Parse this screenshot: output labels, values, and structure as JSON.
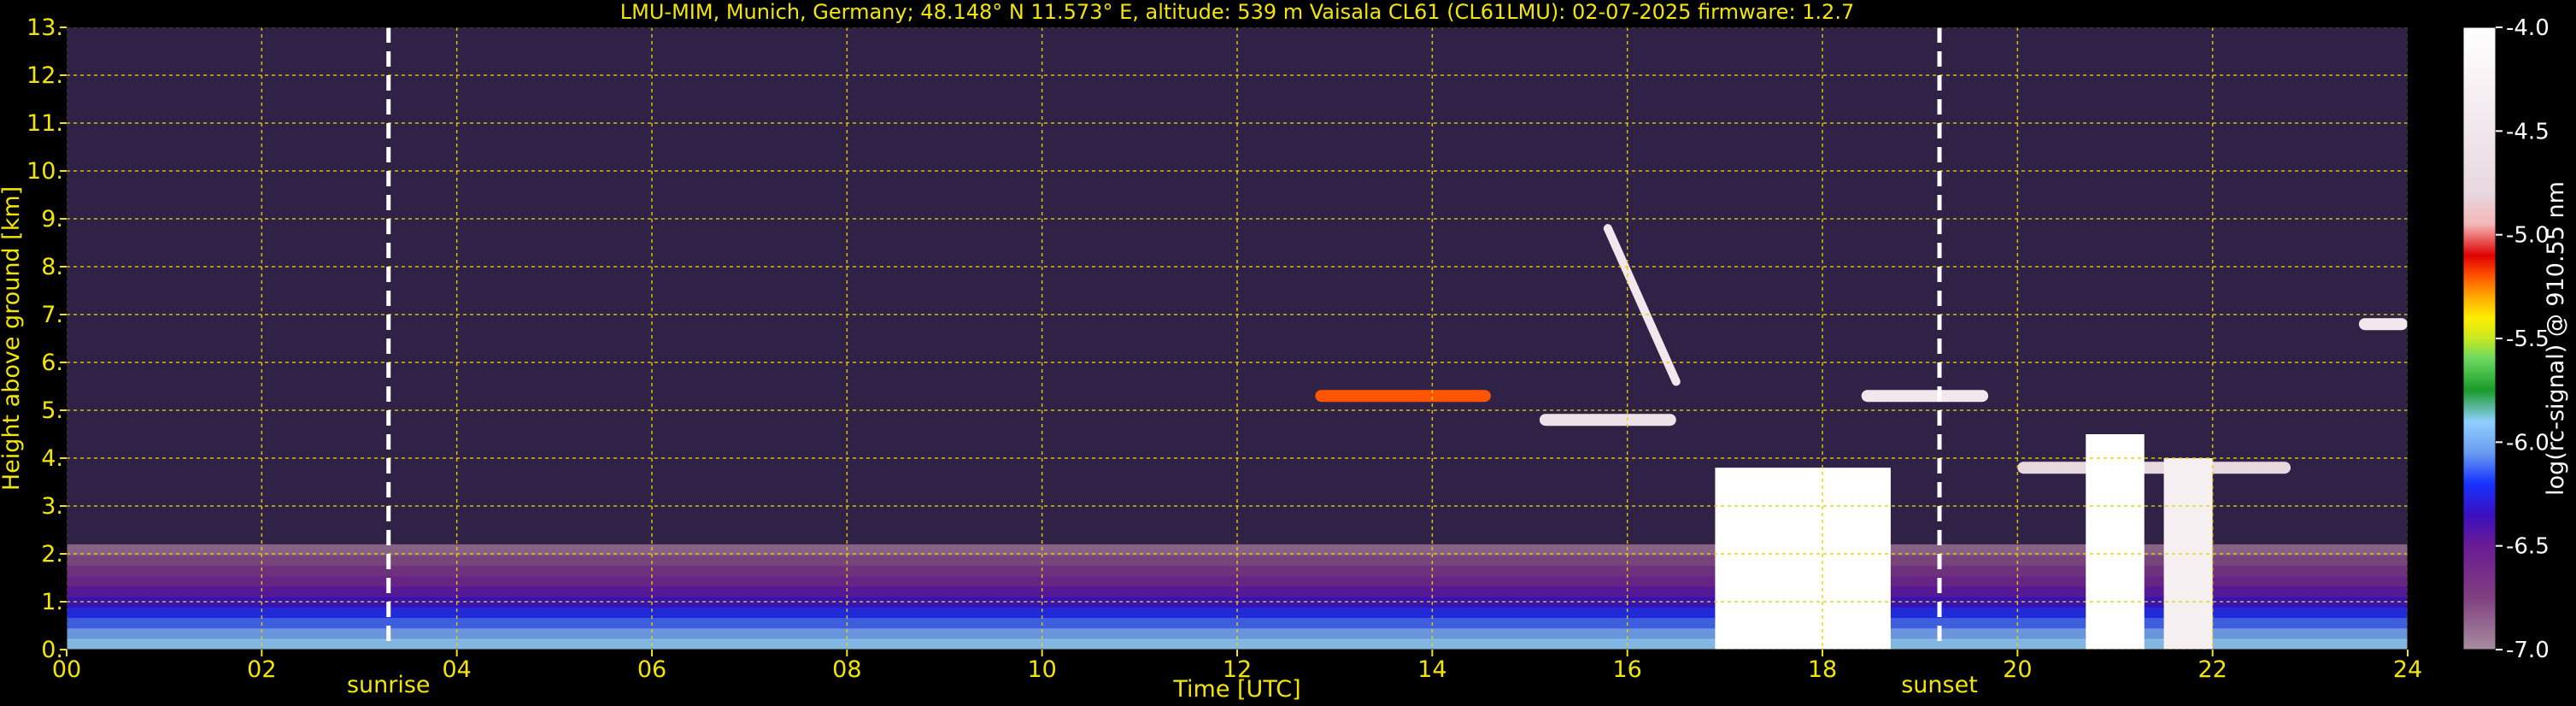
{
  "chart_data": {
    "type": "heatmap",
    "title": "LMU-MIM, Munich, Germany; 48.148° N 11.573° E, altitude: 539 m    Vaisala CL61 (CL61LMU): 02-07-2025    firmware: 1.2.7",
    "xlabel": "Time [UTC]",
    "ylabel": "Height above ground [km]",
    "colorbar_label": "log(rc-signal) @ 910.55 nm",
    "xlim": [
      0,
      24
    ],
    "ylim": [
      0,
      13
    ],
    "x_ticks": [
      "00",
      "02",
      "04",
      "06",
      "08",
      "10",
      "12",
      "14",
      "16",
      "18",
      "20",
      "22",
      "24"
    ],
    "y_ticks": [
      "0.",
      "1.",
      "2.",
      "3.",
      "4.",
      "5.",
      "6.",
      "7.",
      "8.",
      "9.",
      "10.",
      "11.",
      "12.",
      "13."
    ],
    "colorbar_range": [
      -7.0,
      -4.0
    ],
    "colorbar_ticks": [
      "-7.0",
      "-6.5",
      "-6.0",
      "-5.5",
      "-5.0",
      "-4.5",
      "-4.0"
    ],
    "grid": true,
    "annotations": [
      {
        "label": "sunrise",
        "x": 3.3
      },
      {
        "label": "sunset",
        "x": 19.2
      }
    ],
    "features": [
      {
        "kind": "aerosol_layer",
        "t_start": 0,
        "t_end": 24,
        "h_bottom": 0.0,
        "h_top": 2.2,
        "level": -6.3
      },
      {
        "kind": "cloud_layer",
        "t_start": 12.8,
        "t_end": 14.6,
        "h": 5.3,
        "level": -5.2
      },
      {
        "kind": "cloud_layer",
        "t_start": 15.1,
        "t_end": 16.5,
        "h": 4.8,
        "level": -4.6
      },
      {
        "kind": "cirrus_fall",
        "t_start": 15.8,
        "t_end": 16.5,
        "h_top": 8.8,
        "h_bottom": 5.6,
        "level": -4.5
      },
      {
        "kind": "convective_cloud",
        "t_start": 16.9,
        "t_end": 18.7,
        "h_bottom": 0.0,
        "h_top": 3.8,
        "level": -4.0
      },
      {
        "kind": "cloud_layer",
        "t_start": 18.4,
        "t_end": 19.7,
        "h": 5.3,
        "level": -4.5
      },
      {
        "kind": "cloud_layer",
        "t_start": 20.0,
        "t_end": 22.8,
        "h": 3.8,
        "level": -4.8
      },
      {
        "kind": "convective_cloud",
        "t_start": 20.7,
        "t_end": 21.3,
        "h_bottom": 0.0,
        "h_top": 4.5,
        "level": -4.0
      },
      {
        "kind": "convective_cloud",
        "t_start": 21.5,
        "t_end": 22.0,
        "h_bottom": 0.0,
        "h_top": 4.0,
        "level": -4.3
      },
      {
        "kind": "cloud_layer",
        "t_start": 23.5,
        "t_end": 24,
        "h": 6.8,
        "level": -4.5
      }
    ]
  }
}
